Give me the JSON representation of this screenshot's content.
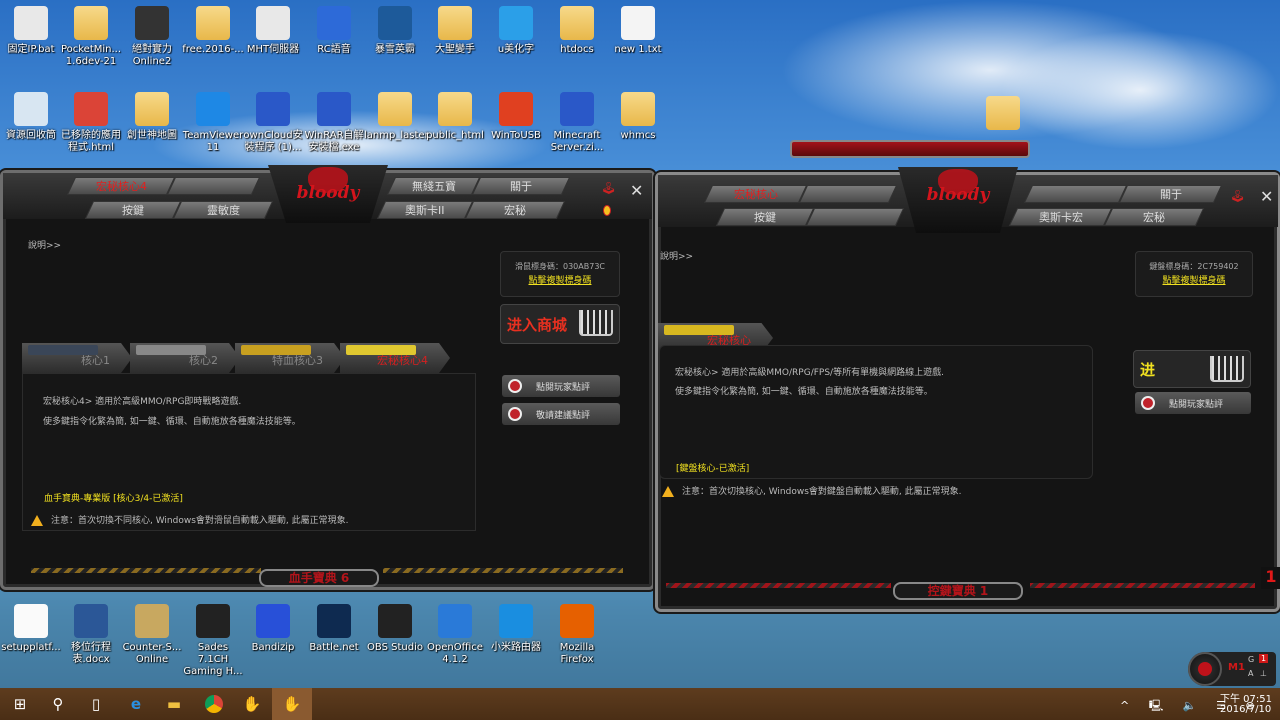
{
  "desktop": {
    "row1": [
      {
        "label": "固定IP.bat",
        "icon": "bat-gear-icon"
      },
      {
        "label": "PocketMin... 1.6dev-21",
        "icon": "folder-icon"
      },
      {
        "label": "絕對實力 Online2",
        "icon": "game-icon"
      },
      {
        "label": "free.2016-...",
        "icon": "folder-icon"
      },
      {
        "label": "MHT伺服器",
        "icon": "bat-gear-icon"
      },
      {
        "label": "RC語音",
        "icon": "rc-voice-icon"
      },
      {
        "label": "暴雪英霸",
        "icon": "heroes-icon"
      },
      {
        "label": "大聖變手",
        "icon": "folder-icon"
      },
      {
        "label": "u美化字",
        "icon": "bird-icon"
      },
      {
        "label": "htdocs",
        "icon": "folder-icon"
      },
      {
        "label": "new 1.txt",
        "icon": "text-file-icon"
      }
    ],
    "row2": [
      {
        "label": "資源回收筒",
        "icon": "recycle-bin-icon"
      },
      {
        "label": "已移除的應用程式.html",
        "icon": "chrome-icon"
      },
      {
        "label": "創世神地圖",
        "icon": "folder-icon"
      },
      {
        "label": "TeamViewer 11",
        "icon": "teamviewer-icon"
      },
      {
        "label": "ownCloud安裝程序 (1)...",
        "icon": "zip-icon"
      },
      {
        "label": "WinRAR自解安裝檔.exe",
        "icon": "exe-icon"
      },
      {
        "label": "lanmp_laster",
        "icon": "folder-icon"
      },
      {
        "label": "public_html",
        "icon": "folder-icon"
      },
      {
        "label": "WinToUSB",
        "icon": "wintousb-icon"
      },
      {
        "label": "Minecraft Server.zi...",
        "icon": "zip-icon"
      },
      {
        "label": "whmcs",
        "icon": "folder-icon"
      }
    ],
    "bottom": [
      {
        "label": "setupplatf...",
        "icon": "file-icon"
      },
      {
        "label": "移位行程表.docx",
        "icon": "word-icon"
      },
      {
        "label": "Counter-S... Online",
        "icon": "counter-strike-icon"
      },
      {
        "label": "Sades 7.1CH Gaming H...",
        "icon": "sades-icon"
      },
      {
        "label": "Bandizip",
        "icon": "bandizip-icon"
      },
      {
        "label": "Battle.net",
        "icon": "battlenet-icon"
      },
      {
        "label": "OBS Studio",
        "icon": "obs-icon"
      },
      {
        "label": "OpenOffice 4.1.2",
        "icon": "openoffice-icon"
      },
      {
        "label": "小米路由器",
        "icon": "wifi-router-icon"
      },
      {
        "label": "Mozilla Firefox",
        "icon": "firefox-icon"
      }
    ]
  },
  "mouse_window": {
    "tabs_left_top": [
      "宏秘核心4",
      ""
    ],
    "tabs_left_bottom": [
      "按鍵",
      "靈敏度"
    ],
    "tabs_right_top": [
      "無綫五寶",
      "關于"
    ],
    "tabs_right_bottom": [
      "奧斯卡II",
      "宏秘"
    ],
    "logo": "bloody",
    "help": "說明>>",
    "id_label": "滑鼠標身碼：030AB73C",
    "copy_link": "點擊複製標身碼",
    "shop": "进入商城",
    "cores": [
      "核心1",
      "核心2",
      "特血核心3",
      "宏秘核心4"
    ],
    "desc1": "宏秘核心4> 適用於高級MMO/RPG即時戰略遊戲.",
    "desc2": "使多鍵指令化繁為簡, 如一鍵、循環、自動施放各種魔法技能等。",
    "status": "血手寶典-專業版 [核心3/4-已激活]",
    "warning": "注意：首次切換不同核心, Windows會對滑鼠自動載入驅動, 此屬正常現象.",
    "review_btn": "點閱玩家點評",
    "suggest_btn": "敬請建議點評",
    "footer": "血手寶典 6"
  },
  "keyboard_window": {
    "tabs_left_top": [
      "宏秘核心",
      ""
    ],
    "tabs_left_bottom": [
      "按鍵",
      ""
    ],
    "tabs_right_top": [
      "",
      "關于"
    ],
    "tabs_right_bottom": [
      "奧斯卡宏",
      "宏秘"
    ],
    "logo": "bloody",
    "help": "說明>>",
    "id_label": "鍵盤標身碼：2C759402",
    "copy_link": "點擊複製標身碼",
    "core": "宏秘核心",
    "desc1": "宏秘核心> 適用於高級MMO/RPG/FPS/等所有單機與網路線上遊戲.",
    "desc2": "使多鍵指令化繁為簡, 如一鍵、循環、自動施放各種魔法技能等。",
    "status": "[鍵盤核心-已激活]",
    "warning": "注意：首次切換核心, Windows會對鍵盤自動載入驅動, 此屬正常現象.",
    "shop": "进",
    "review_btn": "點閱玩家點評",
    "footer": "控鍵寶典 1",
    "side_num": "1"
  },
  "widget": {
    "mode": "M1",
    "g": "G",
    "num": "1",
    "a": "A",
    "b": "⊥"
  },
  "taskbar": {
    "time": "下午 07:51",
    "date": "2016/7/10"
  },
  "colors": {
    "accent": "#d4141c",
    "highlight": "#f0e020",
    "taskbar": "#5e3c1e"
  }
}
